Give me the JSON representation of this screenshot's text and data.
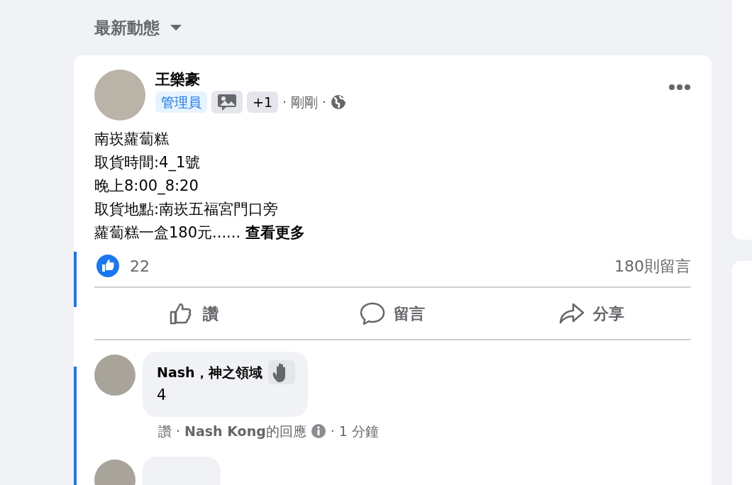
{
  "feed_header": {
    "title": "最新動態"
  },
  "post": {
    "author": "王樂豪",
    "badges": [
      {
        "kind": "role",
        "label": "管理員"
      },
      {
        "kind": "icon"
      },
      {
        "kind": "count",
        "label": "+1"
      }
    ],
    "time": "剛剛",
    "separator": "·",
    "lines": [
      "南崁蘿蔔糕",
      "取貨時間:4_1號",
      "晚上8:00_8:20",
      "取貨地點:南崁五福宮門口旁",
      "蘿蔔糕一盒180元......"
    ],
    "see_more": "查看更多",
    "likes": "22",
    "comments_count": "180則留言",
    "actions": [
      {
        "kind": "like",
        "label": "讚"
      },
      {
        "kind": "comment",
        "label": "留言"
      },
      {
        "kind": "share",
        "label": "分享"
      }
    ]
  },
  "comments": [
    {
      "kind": "full",
      "author": "Nash，神之領域",
      "text": "4",
      "like": "讚",
      "separator": "·",
      "reply": "**Nash Kong**的回應",
      "time": "1 分鐘"
    },
    {
      "kind": "cut"
    }
  ]
}
